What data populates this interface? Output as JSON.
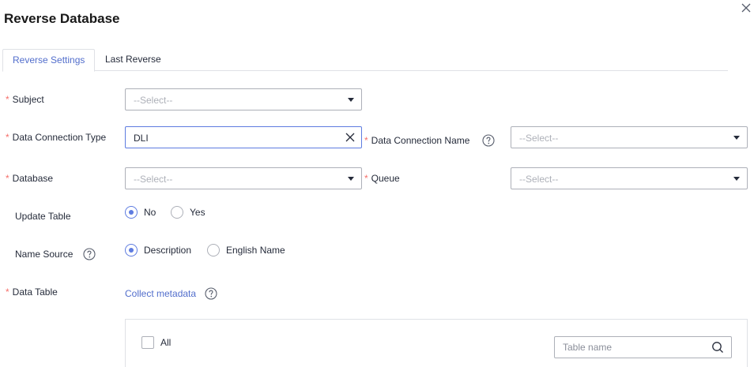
{
  "dialog": {
    "title": "Reverse Database"
  },
  "tabs": [
    {
      "label": "Reverse Settings",
      "active": true
    },
    {
      "label": "Last Reverse",
      "active": false
    }
  ],
  "form": {
    "required_mark": "*",
    "subject": {
      "label": "Subject",
      "placeholder": "--Select--"
    },
    "data_connection_type": {
      "label": "Data Connection Type",
      "value": "DLI"
    },
    "data_connection_name": {
      "label": "Data Connection Name",
      "placeholder": "--Select--"
    },
    "database": {
      "label": "Database",
      "placeholder": "--Select--"
    },
    "queue": {
      "label": "Queue",
      "placeholder": "--Select--"
    },
    "update_table": {
      "label": "Update Table",
      "options": [
        {
          "label": "No",
          "checked": true
        },
        {
          "label": "Yes",
          "checked": false
        }
      ]
    },
    "name_source": {
      "label": "Name Source",
      "options": [
        {
          "label": "Description",
          "checked": true
        },
        {
          "label": "English Name",
          "checked": false
        }
      ]
    },
    "data_table": {
      "label": "Data Table",
      "link": "Collect metadata"
    }
  },
  "table_panel": {
    "select_all_label": "All",
    "search_placeholder": "Table name"
  },
  "colors": {
    "accent": "#5e7ce0",
    "link": "#526ecc",
    "required": "#f66f6a",
    "border": "#adb0b8"
  },
  "icons": [
    "close-icon",
    "clear-icon",
    "help-icon",
    "search-icon",
    "caret-down-icon"
  ]
}
